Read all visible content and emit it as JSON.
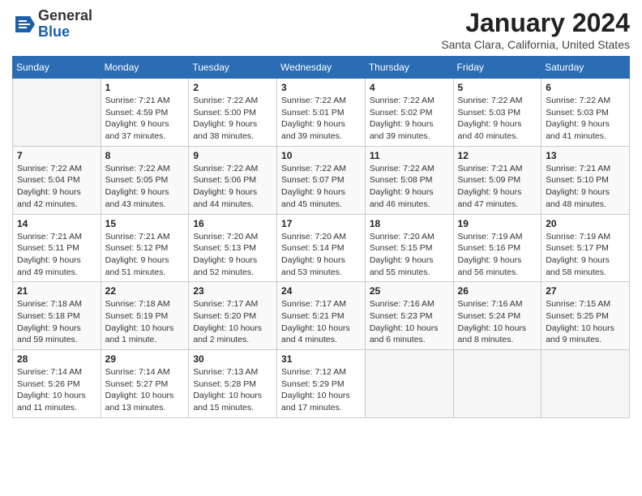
{
  "header": {
    "logo_general": "General",
    "logo_blue": "Blue",
    "month_title": "January 2024",
    "location": "Santa Clara, California, United States"
  },
  "weekdays": [
    "Sunday",
    "Monday",
    "Tuesday",
    "Wednesday",
    "Thursday",
    "Friday",
    "Saturday"
  ],
  "weeks": [
    [
      {
        "day": "",
        "empty": true
      },
      {
        "day": "1",
        "sunrise": "Sunrise: 7:21 AM",
        "sunset": "Sunset: 4:59 PM",
        "daylight": "Daylight: 9 hours and 37 minutes."
      },
      {
        "day": "2",
        "sunrise": "Sunrise: 7:22 AM",
        "sunset": "Sunset: 5:00 PM",
        "daylight": "Daylight: 9 hours and 38 minutes."
      },
      {
        "day": "3",
        "sunrise": "Sunrise: 7:22 AM",
        "sunset": "Sunset: 5:01 PM",
        "daylight": "Daylight: 9 hours and 39 minutes."
      },
      {
        "day": "4",
        "sunrise": "Sunrise: 7:22 AM",
        "sunset": "Sunset: 5:02 PM",
        "daylight": "Daylight: 9 hours and 39 minutes."
      },
      {
        "day": "5",
        "sunrise": "Sunrise: 7:22 AM",
        "sunset": "Sunset: 5:03 PM",
        "daylight": "Daylight: 9 hours and 40 minutes."
      },
      {
        "day": "6",
        "sunrise": "Sunrise: 7:22 AM",
        "sunset": "Sunset: 5:03 PM",
        "daylight": "Daylight: 9 hours and 41 minutes."
      }
    ],
    [
      {
        "day": "7",
        "sunrise": "Sunrise: 7:22 AM",
        "sunset": "Sunset: 5:04 PM",
        "daylight": "Daylight: 9 hours and 42 minutes."
      },
      {
        "day": "8",
        "sunrise": "Sunrise: 7:22 AM",
        "sunset": "Sunset: 5:05 PM",
        "daylight": "Daylight: 9 hours and 43 minutes."
      },
      {
        "day": "9",
        "sunrise": "Sunrise: 7:22 AM",
        "sunset": "Sunset: 5:06 PM",
        "daylight": "Daylight: 9 hours and 44 minutes."
      },
      {
        "day": "10",
        "sunrise": "Sunrise: 7:22 AM",
        "sunset": "Sunset: 5:07 PM",
        "daylight": "Daylight: 9 hours and 45 minutes."
      },
      {
        "day": "11",
        "sunrise": "Sunrise: 7:22 AM",
        "sunset": "Sunset: 5:08 PM",
        "daylight": "Daylight: 9 hours and 46 minutes."
      },
      {
        "day": "12",
        "sunrise": "Sunrise: 7:21 AM",
        "sunset": "Sunset: 5:09 PM",
        "daylight": "Daylight: 9 hours and 47 minutes."
      },
      {
        "day": "13",
        "sunrise": "Sunrise: 7:21 AM",
        "sunset": "Sunset: 5:10 PM",
        "daylight": "Daylight: 9 hours and 48 minutes."
      }
    ],
    [
      {
        "day": "14",
        "sunrise": "Sunrise: 7:21 AM",
        "sunset": "Sunset: 5:11 PM",
        "daylight": "Daylight: 9 hours and 49 minutes."
      },
      {
        "day": "15",
        "sunrise": "Sunrise: 7:21 AM",
        "sunset": "Sunset: 5:12 PM",
        "daylight": "Daylight: 9 hours and 51 minutes."
      },
      {
        "day": "16",
        "sunrise": "Sunrise: 7:20 AM",
        "sunset": "Sunset: 5:13 PM",
        "daylight": "Daylight: 9 hours and 52 minutes."
      },
      {
        "day": "17",
        "sunrise": "Sunrise: 7:20 AM",
        "sunset": "Sunset: 5:14 PM",
        "daylight": "Daylight: 9 hours and 53 minutes."
      },
      {
        "day": "18",
        "sunrise": "Sunrise: 7:20 AM",
        "sunset": "Sunset: 5:15 PM",
        "daylight": "Daylight: 9 hours and 55 minutes."
      },
      {
        "day": "19",
        "sunrise": "Sunrise: 7:19 AM",
        "sunset": "Sunset: 5:16 PM",
        "daylight": "Daylight: 9 hours and 56 minutes."
      },
      {
        "day": "20",
        "sunrise": "Sunrise: 7:19 AM",
        "sunset": "Sunset: 5:17 PM",
        "daylight": "Daylight: 9 hours and 58 minutes."
      }
    ],
    [
      {
        "day": "21",
        "sunrise": "Sunrise: 7:18 AM",
        "sunset": "Sunset: 5:18 PM",
        "daylight": "Daylight: 9 hours and 59 minutes."
      },
      {
        "day": "22",
        "sunrise": "Sunrise: 7:18 AM",
        "sunset": "Sunset: 5:19 PM",
        "daylight": "Daylight: 10 hours and 1 minute."
      },
      {
        "day": "23",
        "sunrise": "Sunrise: 7:17 AM",
        "sunset": "Sunset: 5:20 PM",
        "daylight": "Daylight: 10 hours and 2 minutes."
      },
      {
        "day": "24",
        "sunrise": "Sunrise: 7:17 AM",
        "sunset": "Sunset: 5:21 PM",
        "daylight": "Daylight: 10 hours and 4 minutes."
      },
      {
        "day": "25",
        "sunrise": "Sunrise: 7:16 AM",
        "sunset": "Sunset: 5:23 PM",
        "daylight": "Daylight: 10 hours and 6 minutes."
      },
      {
        "day": "26",
        "sunrise": "Sunrise: 7:16 AM",
        "sunset": "Sunset: 5:24 PM",
        "daylight": "Daylight: 10 hours and 8 minutes."
      },
      {
        "day": "27",
        "sunrise": "Sunrise: 7:15 AM",
        "sunset": "Sunset: 5:25 PM",
        "daylight": "Daylight: 10 hours and 9 minutes."
      }
    ],
    [
      {
        "day": "28",
        "sunrise": "Sunrise: 7:14 AM",
        "sunset": "Sunset: 5:26 PM",
        "daylight": "Daylight: 10 hours and 11 minutes."
      },
      {
        "day": "29",
        "sunrise": "Sunrise: 7:14 AM",
        "sunset": "Sunset: 5:27 PM",
        "daylight": "Daylight: 10 hours and 13 minutes."
      },
      {
        "day": "30",
        "sunrise": "Sunrise: 7:13 AM",
        "sunset": "Sunset: 5:28 PM",
        "daylight": "Daylight: 10 hours and 15 minutes."
      },
      {
        "day": "31",
        "sunrise": "Sunrise: 7:12 AM",
        "sunset": "Sunset: 5:29 PM",
        "daylight": "Daylight: 10 hours and 17 minutes."
      },
      {
        "day": "",
        "empty": true
      },
      {
        "day": "",
        "empty": true
      },
      {
        "day": "",
        "empty": true
      }
    ]
  ]
}
